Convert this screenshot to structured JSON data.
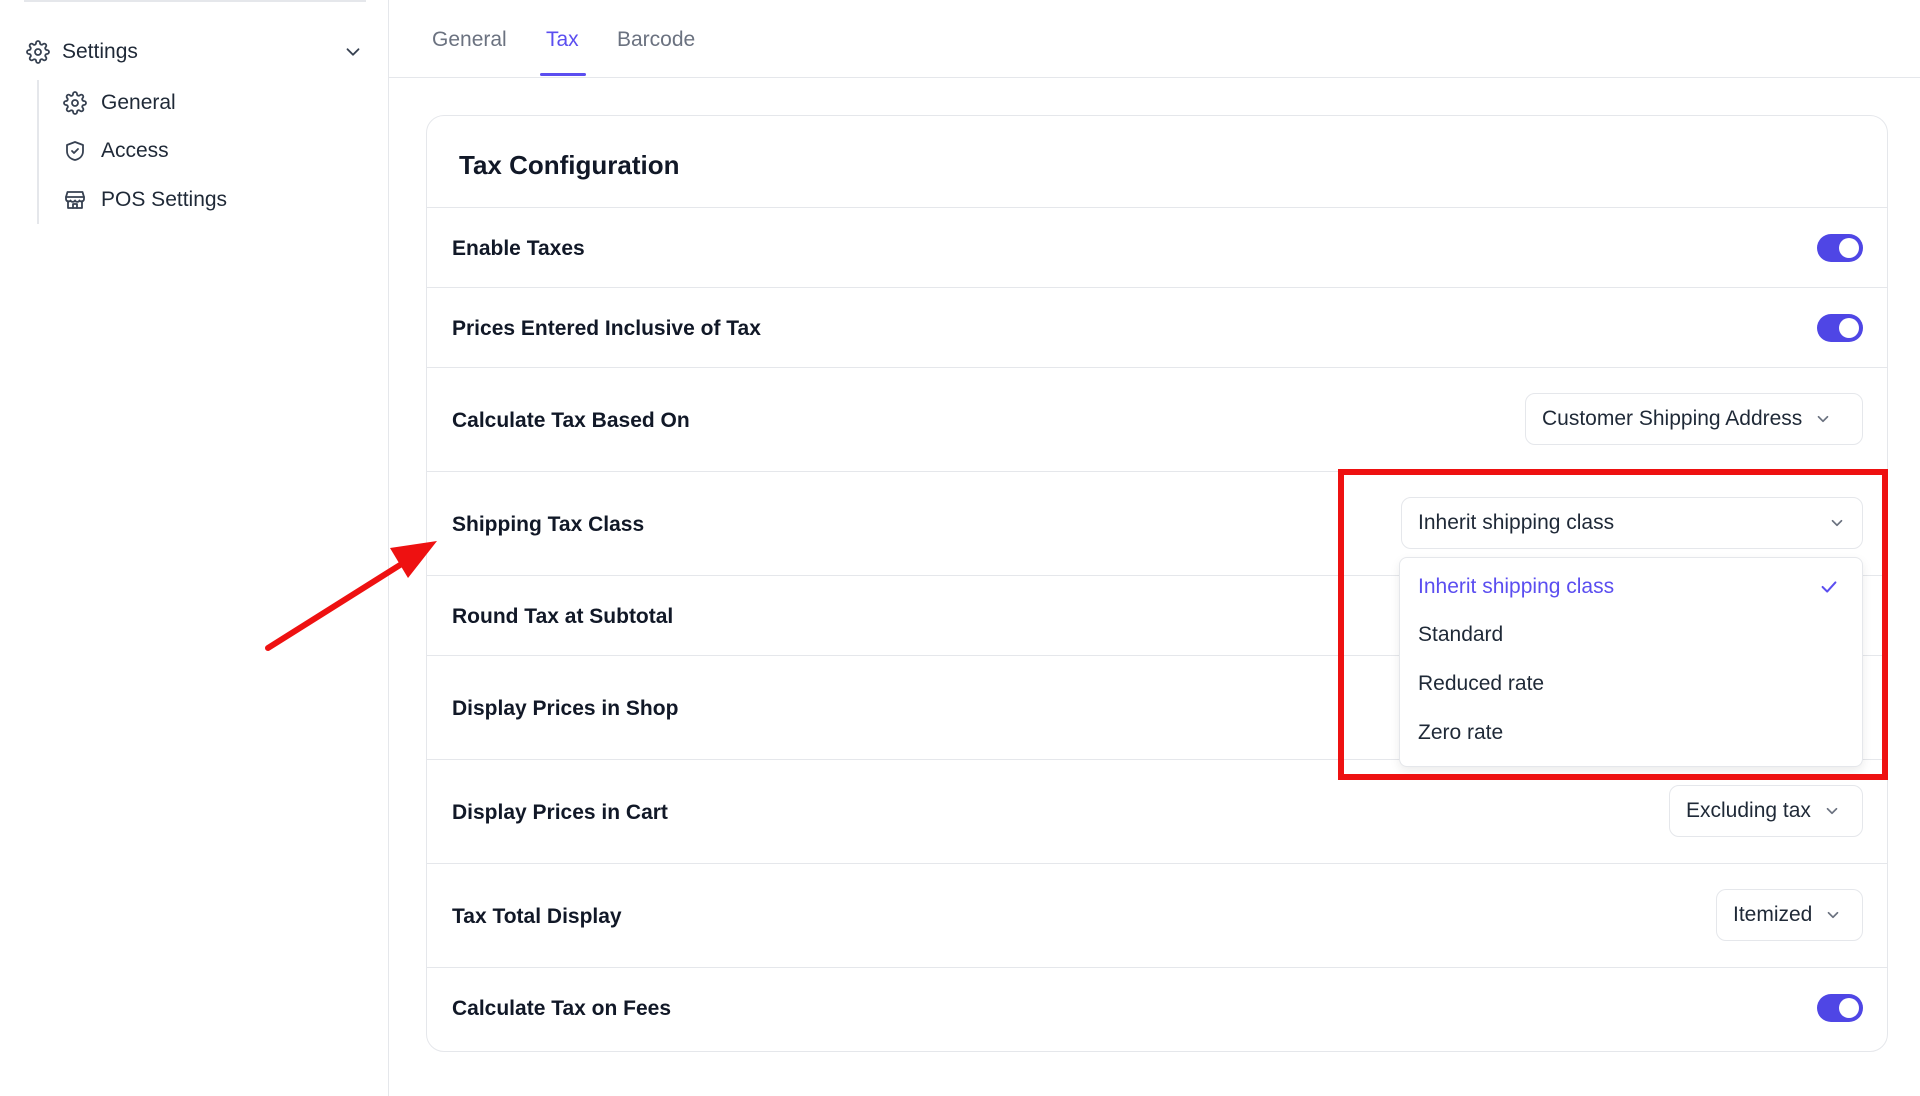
{
  "sidebar": {
    "settings_label": "Settings",
    "items": [
      {
        "label": "General",
        "icon": "gear-icon"
      },
      {
        "label": "Access",
        "icon": "shield-check-icon"
      },
      {
        "label": "POS Settings",
        "icon": "store-icon"
      }
    ]
  },
  "tabs": [
    {
      "label": "General",
      "active": false
    },
    {
      "label": "Tax",
      "active": true
    },
    {
      "label": "Barcode",
      "active": false
    }
  ],
  "card": {
    "title": "Tax Configuration",
    "rows": [
      {
        "label": "Enable Taxes",
        "control": "toggle",
        "on": true
      },
      {
        "label": "Prices Entered Inclusive of Tax",
        "control": "toggle",
        "on": true
      },
      {
        "label": "Calculate Tax Based On",
        "control": "select",
        "value": "Customer Shipping Address"
      },
      {
        "label": "Shipping Tax Class",
        "control": "select",
        "value": "Inherit shipping class"
      },
      {
        "label": "Round Tax at Subtotal",
        "control": "hidden"
      },
      {
        "label": "Display Prices in Shop",
        "control": "hidden"
      },
      {
        "label": "Display Prices in Cart",
        "control": "select",
        "value": "Excluding tax"
      },
      {
        "label": "Tax Total Display",
        "control": "select",
        "value": "Itemized"
      },
      {
        "label": "Calculate Tax on Fees",
        "control": "toggle",
        "on": true
      }
    ]
  },
  "dropdown": {
    "options": [
      {
        "label": "Inherit shipping class",
        "selected": true
      },
      {
        "label": "Standard",
        "selected": false
      },
      {
        "label": "Reduced rate",
        "selected": false
      },
      {
        "label": "Zero rate",
        "selected": false
      }
    ]
  },
  "colors": {
    "accent": "#5b4ef0",
    "toggle_on": "#4f46e5",
    "annotation_red": "#ee1111",
    "border": "#e5e7eb"
  }
}
